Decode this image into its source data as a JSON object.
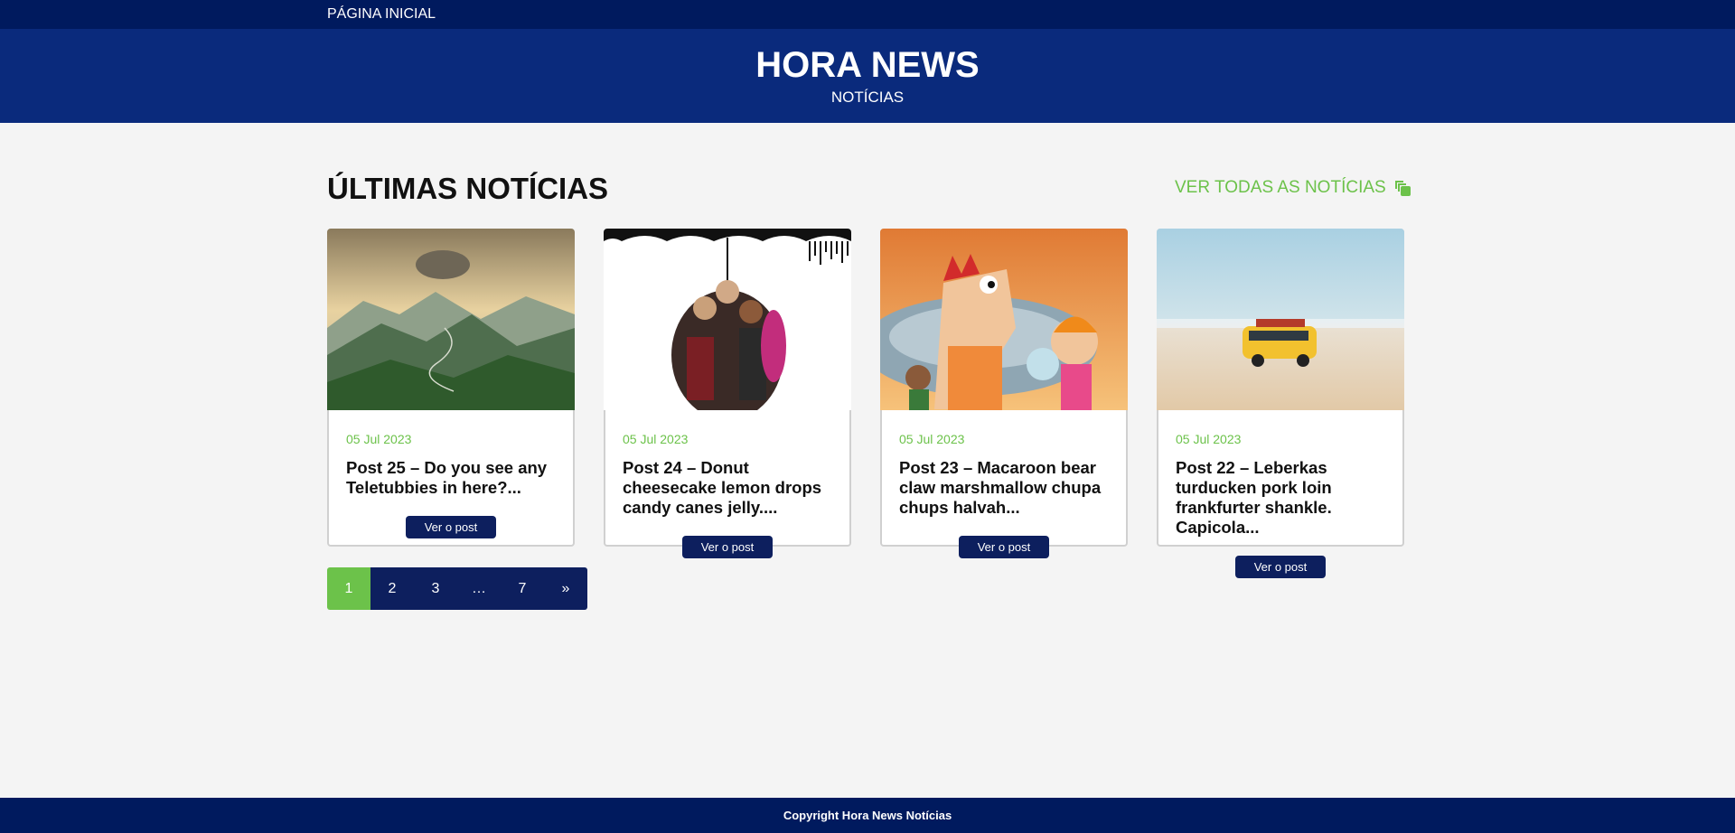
{
  "nav": {
    "home_label": "PÁGINA INICIAL"
  },
  "header": {
    "title": "HORA NEWS",
    "subtitle": "NOTÍCIAS"
  },
  "section": {
    "title": "ÚLTIMAS NOTÍCIAS",
    "view_all_label": "VER TODAS AS NOTÍCIAS",
    "view_all_icon": "copy-icon"
  },
  "posts": [
    {
      "date": "05 Jul 2023",
      "title": "Post 25 – Do you see any Teletubbies in here?...",
      "button": "Ver o post",
      "image": "mountain-sunset"
    },
    {
      "date": "05 Jul 2023",
      "title": "Post 24 – Donut cheesecake lemon drops candy canes jelly....",
      "button": "Ver o post",
      "image": "umbrella-group"
    },
    {
      "date": "05 Jul 2023",
      "title": "Post 23 – Macaroon bear claw marshmallow chupa chups halvah...",
      "button": "Ver o post",
      "image": "cartoon-characters"
    },
    {
      "date": "05 Jul 2023",
      "title": "Post 22 – Leberkas turducken pork loin frankfurter shankle. Capicola...",
      "button": "Ver o post",
      "image": "toy-bus-beach"
    }
  ],
  "pagination": {
    "pages": [
      "1",
      "2",
      "3",
      "…",
      "7",
      "»"
    ],
    "active": "1"
  },
  "footer": {
    "copyright": "Copyright Hora News Notícias"
  },
  "colors": {
    "nav_bg": "#001a5e",
    "header_bg": "#0a2a7c",
    "accent": "#6cc24a",
    "button": "#0d1f5e",
    "page_bg": "#f4f4f4"
  }
}
